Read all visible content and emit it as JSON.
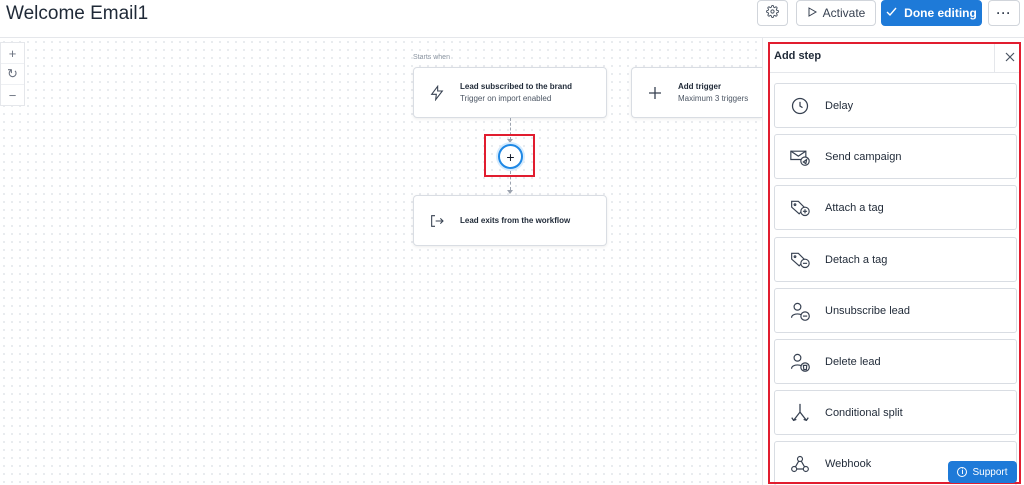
{
  "header": {
    "title": "Welcome Email1",
    "activate_label": "Activate",
    "done_label": "Done editing",
    "more_label": "···"
  },
  "zoom": {
    "in": "+",
    "reset": "↻",
    "out": "−"
  },
  "canvas": {
    "starts_when": "Starts when",
    "trigger_node": {
      "title": "Lead subscribed to the brand",
      "subtitle": "Trigger on import enabled",
      "icon": "lightning-icon"
    },
    "add_trigger_node": {
      "title": "Add trigger",
      "subtitle": "Maximum 3 triggers",
      "icon": "plus-icon"
    },
    "exit_node": {
      "title": "Lead exits from the workflow",
      "icon": "exit-icon"
    },
    "add_step_symbol": "+"
  },
  "panel": {
    "title": "Add step",
    "steps": [
      {
        "label": "Delay",
        "icon": "clock-icon"
      },
      {
        "label": "Send campaign",
        "icon": "envelope-send-icon"
      },
      {
        "label": "Attach a tag",
        "icon": "tag-plus-icon"
      },
      {
        "label": "Detach a tag",
        "icon": "tag-minus-icon"
      },
      {
        "label": "Unsubscribe lead",
        "icon": "user-minus-icon"
      },
      {
        "label": "Delete lead",
        "icon": "user-delete-icon"
      },
      {
        "label": "Conditional split",
        "icon": "split-arrows-icon"
      },
      {
        "label": "Webhook",
        "icon": "webhook-icon"
      }
    ]
  },
  "support_label": "Support",
  "colors": {
    "accent": "#1e7ad8",
    "highlight": "#e11d2f",
    "add_ring": "#1e88e5"
  }
}
